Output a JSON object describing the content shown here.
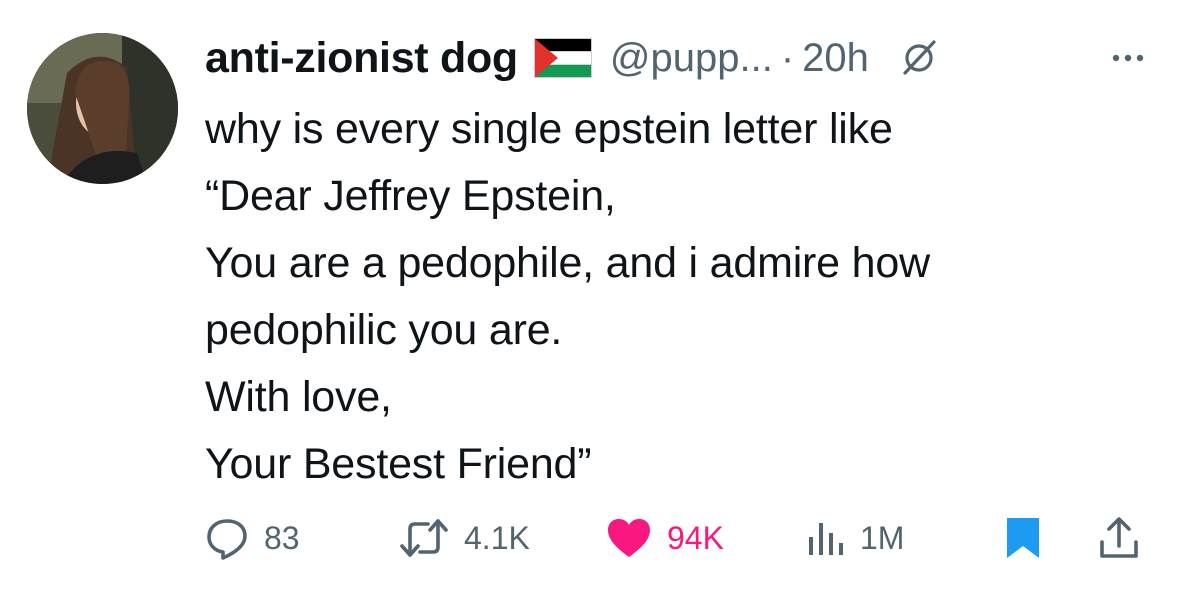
{
  "author": {
    "display_name": "anti-zionist dog",
    "handle": "@pupp...",
    "separator": "·",
    "time": "20h",
    "flag_icon": "palestine-flag-icon"
  },
  "tweet": {
    "lines": [
      "why is every single epstein letter like",
      "“Dear Jeffrey Epstein,",
      "You are a pedophile, and i admire how",
      "pedophilic you are.",
      "With love,",
      "Your Bestest Friend”"
    ]
  },
  "actions": {
    "replies": "83",
    "retweets": "4.1K",
    "likes": "94K",
    "views": "1M",
    "liked": true,
    "bookmarked": true
  },
  "colors": {
    "text": "#0f1419",
    "secondary": "#536471",
    "like": "#f91880",
    "bookmark": "#1d9bf0"
  }
}
